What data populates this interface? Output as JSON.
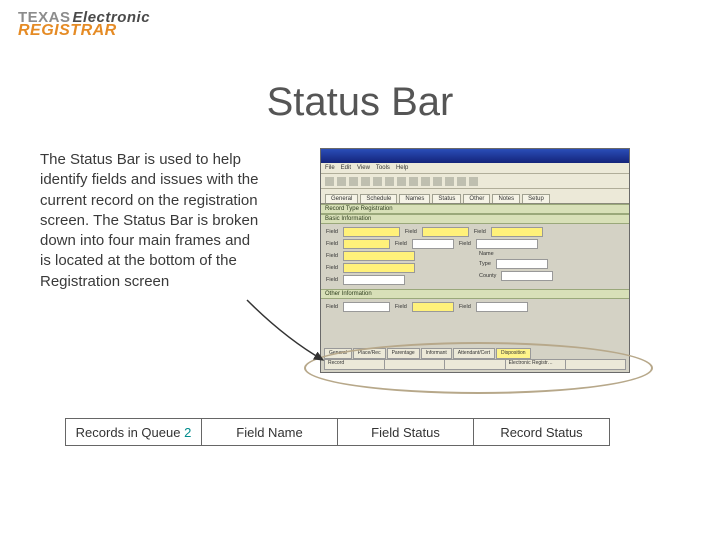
{
  "logo": {
    "word1": "TEXAS",
    "word2": "Electronic",
    "word3": "REGISTRAR"
  },
  "title": "Status Bar",
  "body": "The Status Bar is used to help identify fields and issues with the current record on the registration screen. The Status Bar is broken down into four main frames and is located at the bottom of the Registration screen",
  "statusFrames": {
    "cell1_label": "Records in Queue",
    "cell1_count": "2",
    "cell2": "Field Name",
    "cell3": "Field Status",
    "cell4": "Record Status"
  },
  "mock": {
    "menus": [
      "File",
      "Edit",
      "View",
      "Tools",
      "Help"
    ],
    "tabs": [
      "General",
      "Schedule",
      "Names",
      "Status",
      "Other",
      "Notes",
      "Setup"
    ],
    "section1": "Record Type Registration",
    "section2": "Basic Information",
    "section3": "Other Information",
    "bottomTabs": [
      "General",
      "Place/Rec",
      "Parentage",
      "Informant",
      "Attendant/Cert",
      "Disposition"
    ],
    "statusCells": [
      "Record",
      "",
      "",
      "Electronic Registr…",
      ""
    ]
  }
}
